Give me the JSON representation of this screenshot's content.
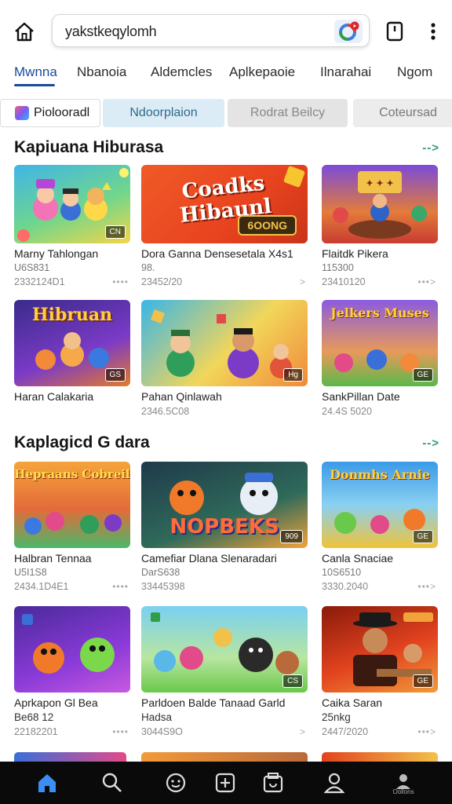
{
  "topbar": {
    "url_text": "yakstkeqylomh"
  },
  "nav": {
    "items": [
      "Mwnna",
      "Nbanoia",
      "Aldemcles",
      "Aplkepaoie",
      "Ilnarahai",
      "Ngom"
    ]
  },
  "chips": [
    "Piolooradl",
    "Ndoorplaion",
    "Rodrat Beilcy",
    "Coteursad"
  ],
  "section1": {
    "title": "Kapiuana Hiburasa",
    "more": "-->",
    "row1": [
      {
        "title": "Marny Tahlongan",
        "sub": "U6S831",
        "date": "2332124D1",
        "thumb_text": "",
        "badge": "CN"
      },
      {
        "title": "Dora Ganna Densesetala X4s1",
        "sub": "98.",
        "date": "23452/20",
        "thumb_text": "Coadks Hibaunl",
        "sub_badge": "6OONG"
      },
      {
        "title": "Flaitdk Pikera",
        "sub": "115300",
        "date": "23410120",
        "thumb_text": "",
        "badge": ""
      }
    ],
    "row2": [
      {
        "title": "Haran Calakaria",
        "date": "",
        "thumb_text": "Hibruan",
        "badge": "GS"
      },
      {
        "title": "Pahan Qinlawah",
        "date": "2346.5C08",
        "thumb_text": "",
        "badge": "Hg"
      },
      {
        "title": "SankPillan Date",
        "date": "24.4S 5020",
        "thumb_text": "Jelkers Muses",
        "badge": "GE"
      }
    ]
  },
  "section2": {
    "title": "Kaplagicd G dara",
    "more": "-->",
    "row1": [
      {
        "title": "Halbran Tennaa",
        "sub": "U5I1S8",
        "date": "2434.1D4E1",
        "thumb_text": "Hepraans Cobreil"
      },
      {
        "title": "Camefiar Dlana Slenaradari",
        "sub": "DarS638",
        "date": "33445398",
        "thumb_text": "NOPBEKS",
        "badge": "909"
      },
      {
        "title": "Canla Snaciae",
        "sub": "10S6510",
        "date": "3330.2040",
        "thumb_text": "Donmhs Arnie",
        "badge": "GE"
      }
    ],
    "row2": [
      {
        "title": "Aprkapon Gl Bea",
        "sub": "Be68 12",
        "date": "22182201",
        "badge": ""
      },
      {
        "title": "Parldoen Balde Tanaad Garld",
        "sub": "Hadsa",
        "date": "3044S9O",
        "badge": "CS"
      },
      {
        "title": "Caika Saran",
        "sub": "25nkg",
        "date": "2447/2020",
        "badge": "GE"
      }
    ]
  },
  "bottomnav": {
    "items": [
      "home-icon",
      "search-icon",
      "face-icon",
      "add-icon",
      "library-icon",
      "profile-icon",
      "account-icon"
    ],
    "last_label": "Oollons"
  },
  "colors": {
    "accent": "#1a4a9a",
    "more_arrow": "#2e9a6a",
    "bottom_bar": "#0a0a0a"
  }
}
